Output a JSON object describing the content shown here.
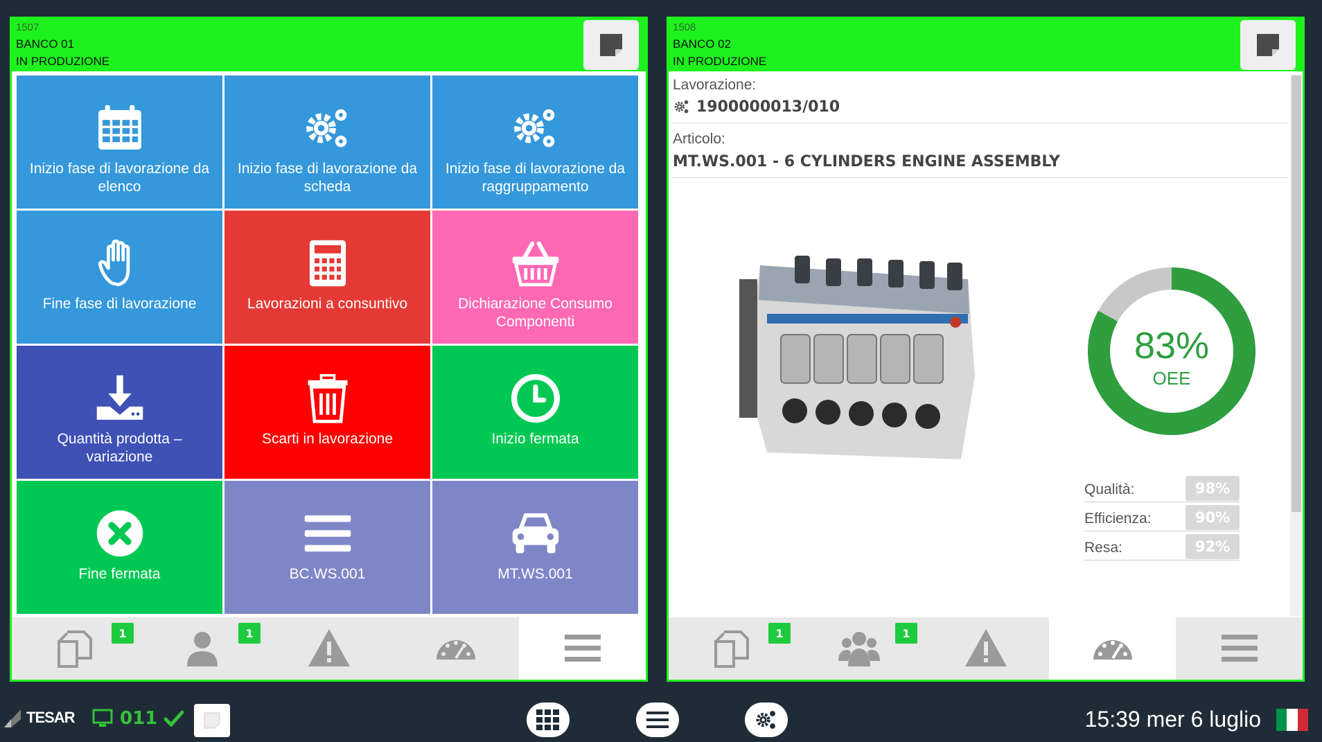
{
  "left_panel": {
    "id": "1507",
    "bench": "BANCO 01",
    "status": "IN PRODUZIONE",
    "tiles": [
      {
        "label": "Inizio fase di lavorazione da elenco",
        "icon": "calendar-icon",
        "color": "#3498db"
      },
      {
        "label": "Inizio fase di lavorazione da scheda",
        "icon": "gears-icon",
        "color": "#3498db"
      },
      {
        "label": "Inizio fase di lavorazione da raggruppamento",
        "icon": "gears-icon",
        "color": "#3498db"
      },
      {
        "label": "Fine fase di lavorazione",
        "icon": "hand-icon",
        "color": "#3498db"
      },
      {
        "label": "Lavorazioni a consuntivo",
        "icon": "calculator-icon",
        "color": "#e53935"
      },
      {
        "label": "Dichiarazione Consumo Componenti",
        "icon": "basket-icon",
        "color": "#ff69b4"
      },
      {
        "label": "Quantità prodotta – variazione",
        "icon": "download-icon",
        "color": "#3f51b5"
      },
      {
        "label": "Scarti in lavorazione",
        "icon": "trash-icon",
        "color": "#ff0000"
      },
      {
        "label": "Inizio fermata",
        "icon": "clock-icon",
        "color": "#00c853"
      },
      {
        "label": "Fine fermata",
        "icon": "close-circle-icon",
        "color": "#00c853"
      },
      {
        "label": "BC.WS.001",
        "icon": "list-icon",
        "color": "#7f86c8"
      },
      {
        "label": "MT.WS.001",
        "icon": "car-icon",
        "color": "#7f86c8"
      }
    ],
    "tabs": [
      {
        "icon": "copy-icon",
        "badge": "1"
      },
      {
        "icon": "user-icon",
        "badge": "1"
      },
      {
        "icon": "warning-icon",
        "badge": ""
      },
      {
        "icon": "gauge-icon",
        "badge": ""
      },
      {
        "icon": "menu-icon",
        "badge": ""
      }
    ]
  },
  "right_panel": {
    "id": "1508",
    "bench": "BANCO 02",
    "status": "IN PRODUZIONE",
    "work_label": "Lavorazione:",
    "work_value": "1900000013/010",
    "article_label": "Articolo:",
    "article_value": "MT.WS.001 - 6 CYLINDERS ENGINE ASSEMBLY",
    "oee": {
      "value": 83,
      "percent_text": "83%",
      "label": "OEE"
    },
    "stats": [
      {
        "label": "Qualità:",
        "value": "98%"
      },
      {
        "label": "Efficienza:",
        "value": "90%"
      },
      {
        "label": "Resa:",
        "value": "92%"
      }
    ],
    "tabs": [
      {
        "icon": "copy-icon",
        "badge": "1"
      },
      {
        "icon": "users-icon",
        "badge": "1"
      },
      {
        "icon": "warning-icon",
        "badge": ""
      },
      {
        "icon": "gauge-icon",
        "badge": ""
      },
      {
        "icon": "menu-icon",
        "badge": ""
      }
    ]
  },
  "statusbar": {
    "logo": "TESAR",
    "station": "011",
    "datetime": "15:39 mer 6 luglio",
    "flag_colors": [
      "#009246",
      "#ffffff",
      "#ce2b37"
    ]
  },
  "colors": {
    "green_header": "#1ef21e",
    "badge": "#1ecb3e",
    "oee_green": "#2e9e3e",
    "oee_grey": "#c8c8c8"
  }
}
